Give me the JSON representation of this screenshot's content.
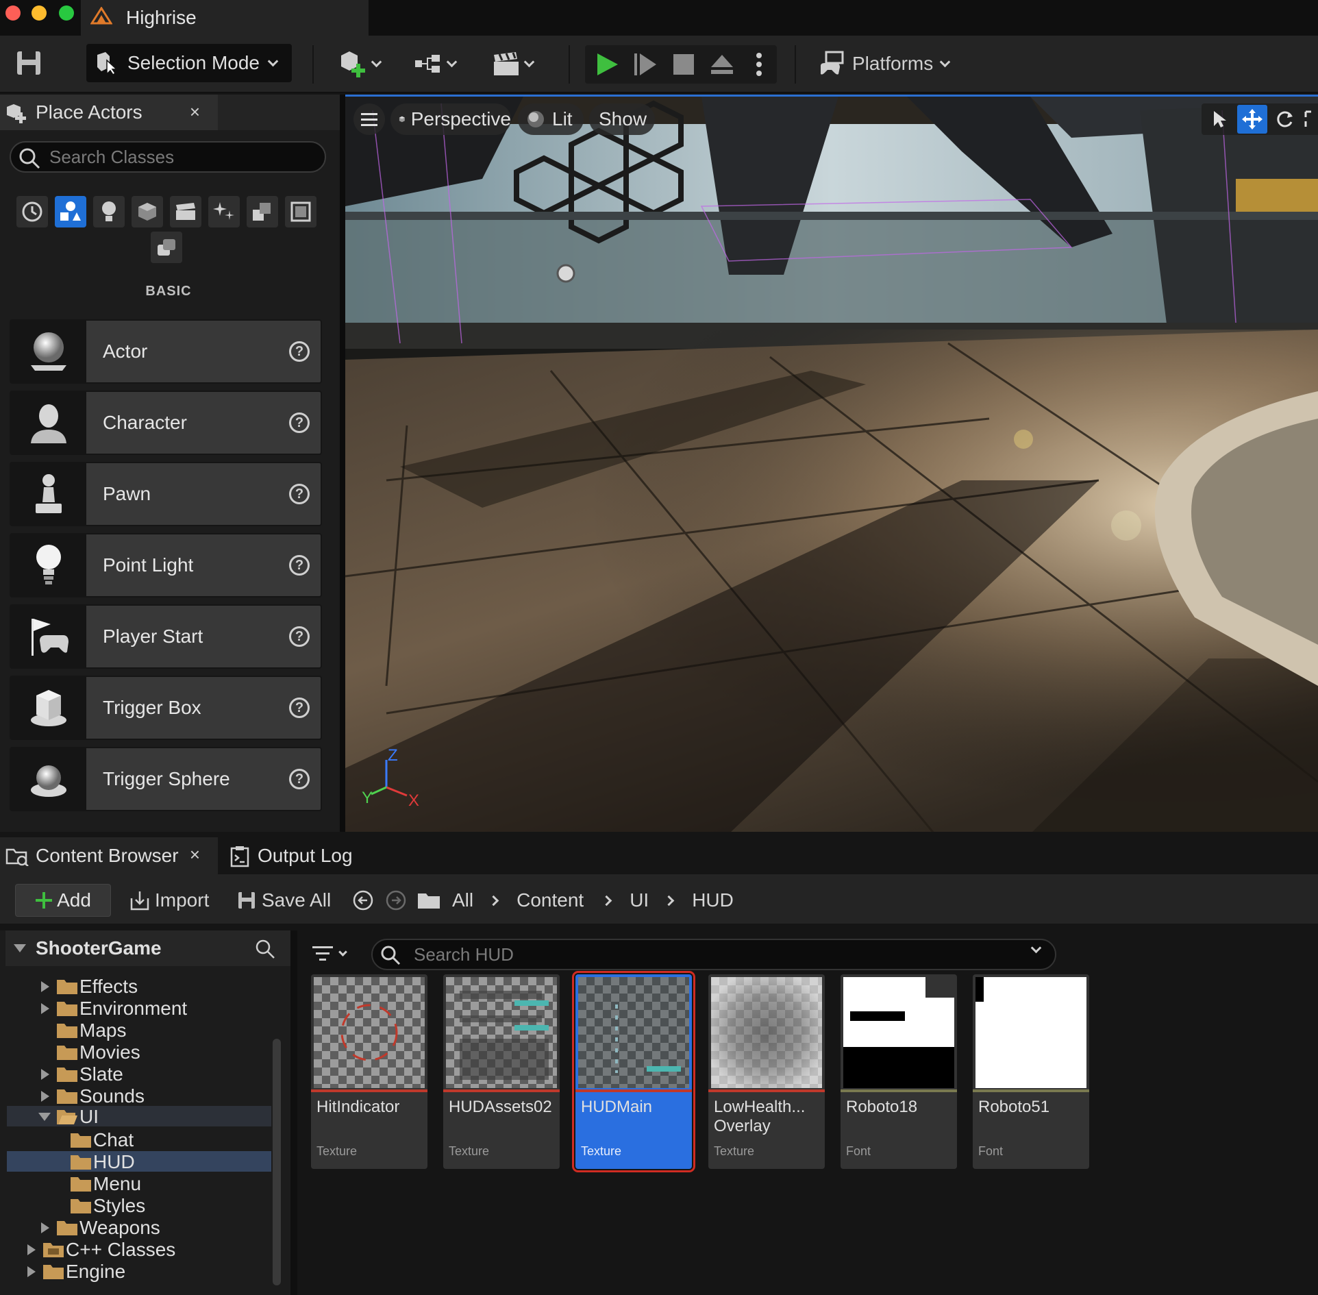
{
  "window": {
    "title": "Highrise"
  },
  "toolbar": {
    "selection_mode": "Selection Mode",
    "platforms": "Platforms"
  },
  "place_actors": {
    "tab_label": "Place Actors",
    "close": "×",
    "search_placeholder": "Search Classes",
    "category_label": "BASIC",
    "categories": [
      "recent-icon",
      "basic-shapes-icon",
      "lights-icon",
      "cube-icon",
      "cinematic-icon",
      "visual-effects-icon",
      "volumes-icon",
      "all-classes-icon",
      "extra-icon"
    ],
    "items": [
      {
        "label": "Actor",
        "icon": "sphere-actor-icon"
      },
      {
        "label": "Character",
        "icon": "character-icon"
      },
      {
        "label": "Pawn",
        "icon": "pawn-icon"
      },
      {
        "label": "Point Light",
        "icon": "point-light-icon"
      },
      {
        "label": "Player Start",
        "icon": "player-start-icon"
      },
      {
        "label": "Trigger Box",
        "icon": "trigger-box-icon"
      },
      {
        "label": "Trigger Sphere",
        "icon": "trigger-sphere-icon"
      }
    ],
    "help": "?"
  },
  "viewport": {
    "perspective": "Perspective",
    "lit": "Lit",
    "show": "Show",
    "axis_z": "Z",
    "axis_y": "Y",
    "axis_x": "X"
  },
  "dock": {
    "tabs": [
      {
        "label": "Content Browser",
        "close": "×"
      },
      {
        "label": "Output Log"
      }
    ]
  },
  "content_browser": {
    "add": "Add",
    "import": "Import",
    "save_all": "Save All",
    "breadcrumb": [
      "All",
      "Content",
      "UI",
      "HUD"
    ],
    "search_placeholder": "Search HUD",
    "tree": {
      "root": "ShooterGame",
      "items": [
        {
          "label": "Effects"
        },
        {
          "label": "Environment"
        },
        {
          "label": "Maps"
        },
        {
          "label": "Movies"
        },
        {
          "label": "Slate"
        },
        {
          "label": "Sounds"
        },
        {
          "label": "UI"
        },
        {
          "label": "Chat"
        },
        {
          "label": "HUD"
        },
        {
          "label": "Menu"
        },
        {
          "label": "Styles"
        },
        {
          "label": "Weapons"
        },
        {
          "label": "C++ Classes"
        },
        {
          "label": "Engine"
        }
      ]
    },
    "assets": [
      {
        "name": "HitIndicator",
        "type": "Texture",
        "bar": "#c0392b"
      },
      {
        "name": "HUDAssets02",
        "type": "Texture",
        "bar": "#c0392b"
      },
      {
        "name": "HUDMain",
        "type": "Texture",
        "bar": "#c0392b"
      },
      {
        "name": "LowHealth... Overlay",
        "type": "Texture",
        "bar": "#c0392b"
      },
      {
        "name": "Roboto18",
        "type": "Font",
        "bar": "#7a7a50"
      },
      {
        "name": "Roboto51",
        "type": "Font",
        "bar": "#7a7a50"
      }
    ]
  },
  "colors": {
    "accent": "#2b6fd1",
    "selection": "#2a6fe0",
    "folder": "#c79a56",
    "play": "#3fbf3f"
  }
}
